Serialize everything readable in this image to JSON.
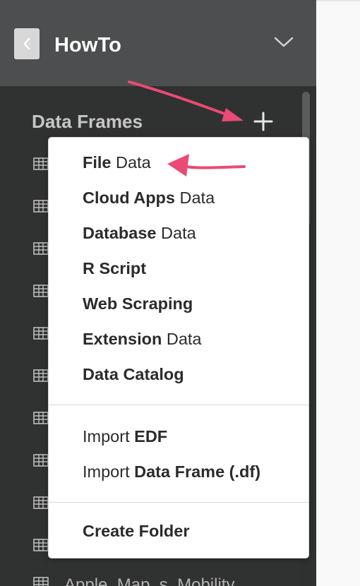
{
  "header": {
    "back_label": "<",
    "title": "HowTo",
    "dropdown_icon": "chevron-down-icon"
  },
  "section": {
    "title": "Data Frames",
    "add_label": "+"
  },
  "sidebar_items": [
    {
      "label": ""
    },
    {
      "label": ""
    },
    {
      "label": ""
    },
    {
      "label": ""
    },
    {
      "label": ""
    },
    {
      "label": ""
    },
    {
      "label": ""
    },
    {
      "label": ""
    },
    {
      "label": ""
    },
    {
      "label": ""
    },
    {
      "label": "Apple_Map_s_Mobility"
    }
  ],
  "menu": {
    "file_data": {
      "bold": "File",
      "rest": " Data"
    },
    "cloud_apps_data": {
      "bold": "Cloud Apps",
      "rest": " Data"
    },
    "database_data": {
      "bold": "Database",
      "rest": " Data"
    },
    "r_script": {
      "bold": "R Script",
      "rest": ""
    },
    "web_scraping": {
      "bold": "Web Scraping",
      "rest": ""
    },
    "extension_data": {
      "bold": "Extension",
      "rest": " Data"
    },
    "data_catalog": {
      "bold": "Data Catalog",
      "rest": ""
    },
    "import_edf": {
      "prefix": "Import ",
      "bold": "EDF"
    },
    "import_data_frame": {
      "prefix": "Import ",
      "bold": "Data Frame (.df)"
    },
    "create_folder": {
      "bold": "Create Folder",
      "rest": ""
    }
  },
  "colors": {
    "sidebar": "#303131",
    "header": "#4d4e4f",
    "annotation_arrow": "#ea4a75",
    "menu_background": "#ffffff"
  }
}
